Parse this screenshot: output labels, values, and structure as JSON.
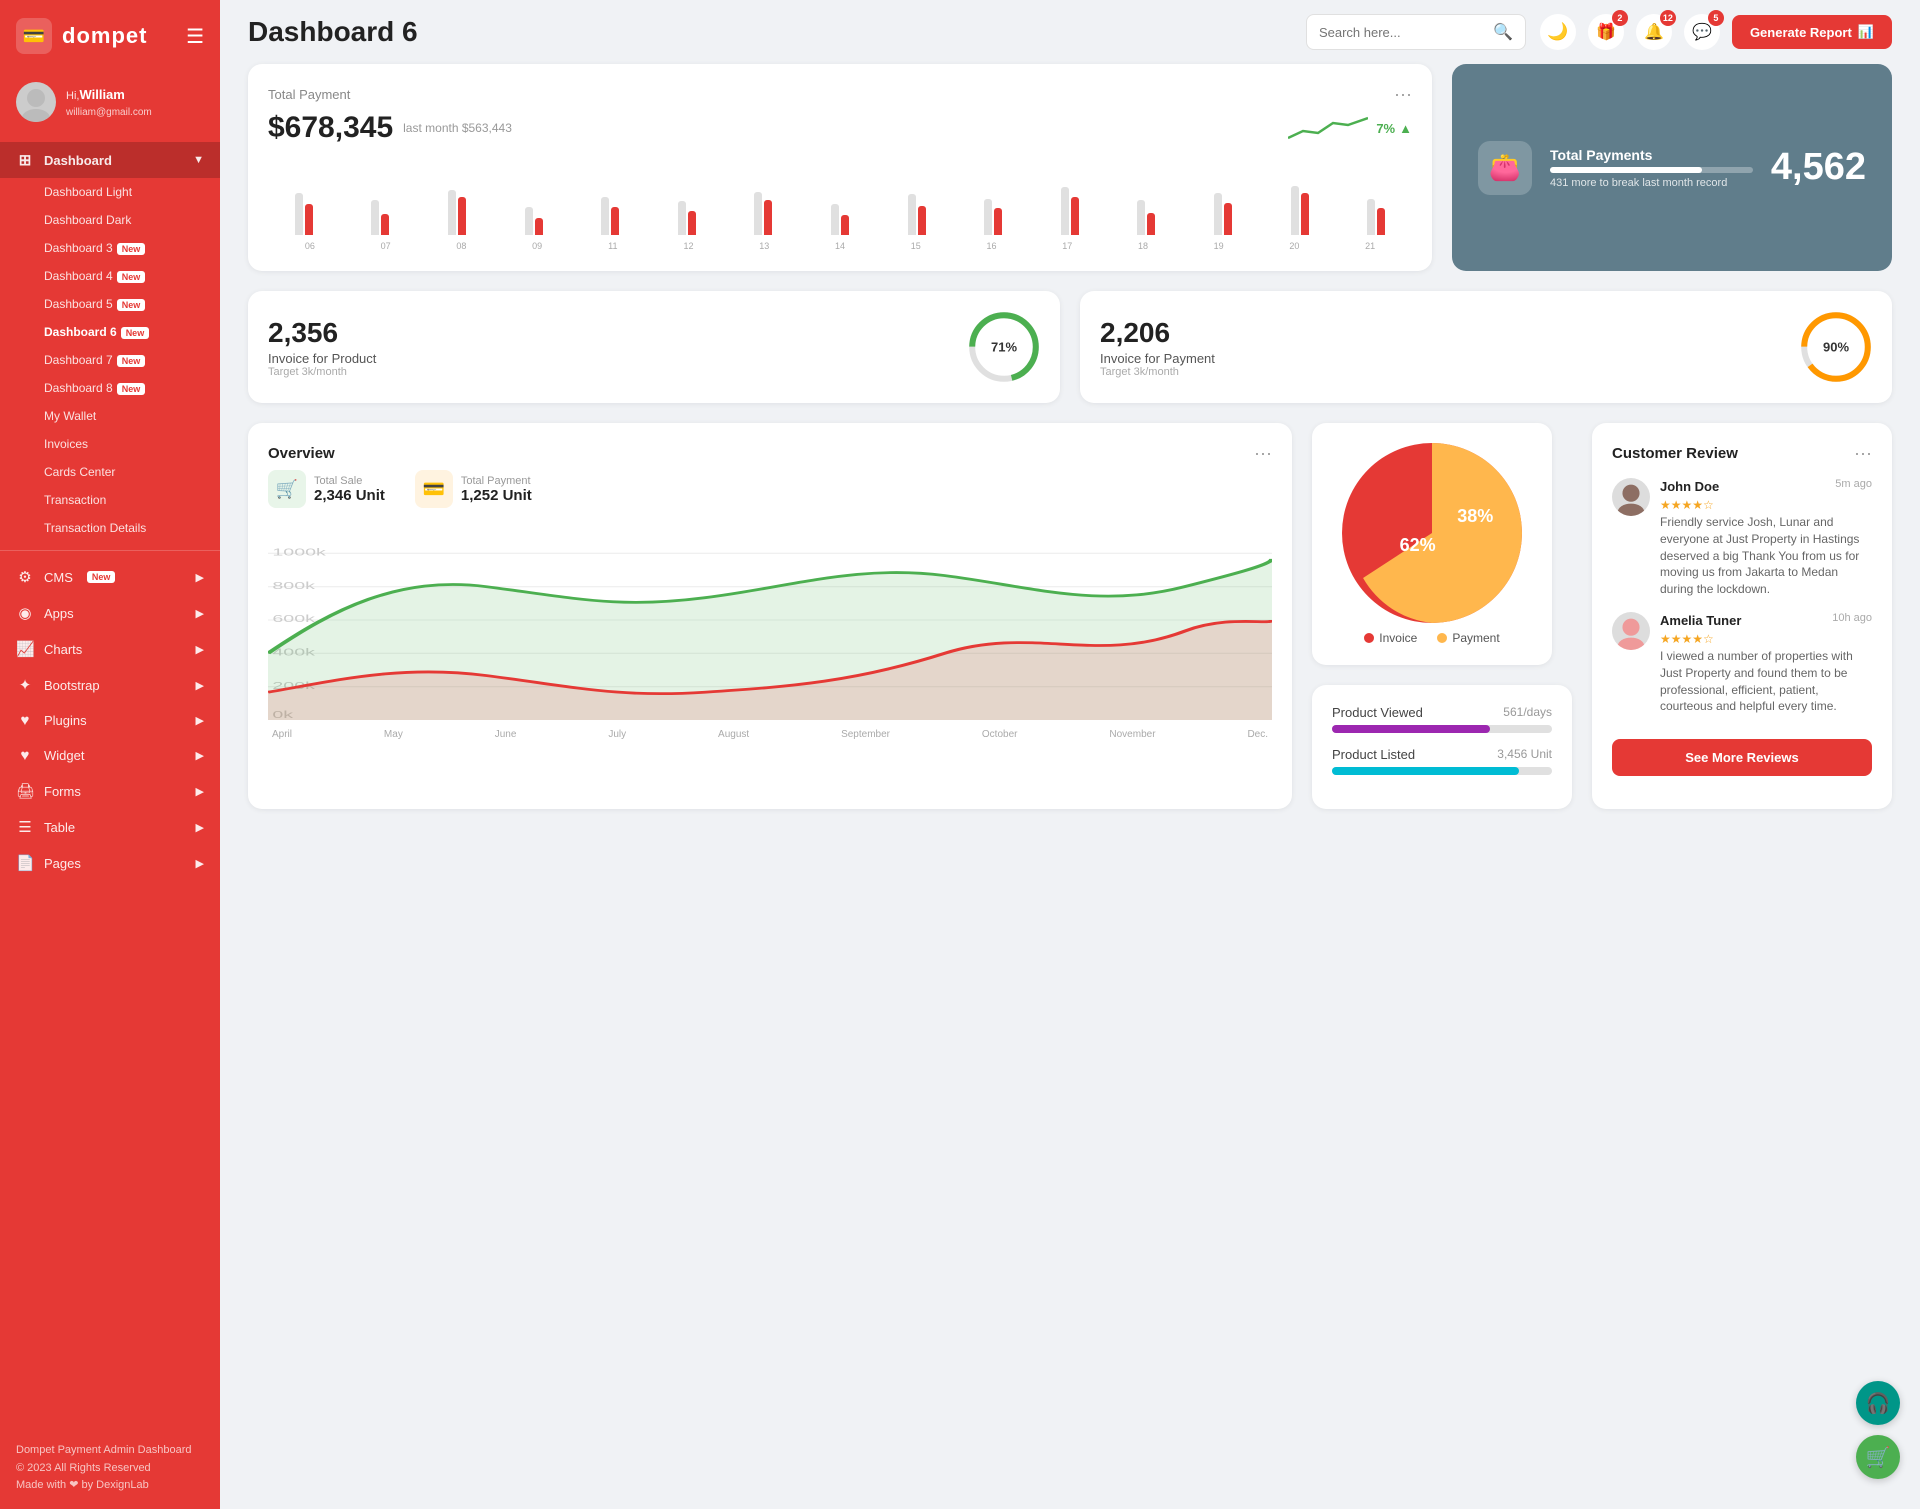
{
  "app": {
    "name": "dompet",
    "logo_icon": "💳"
  },
  "user": {
    "greeting": "Hi,",
    "name": "William",
    "email": "william@gmail.com"
  },
  "header": {
    "title": "Dashboard 6",
    "search_placeholder": "Search here...",
    "generate_report_label": "Generate Report",
    "notifications": {
      "gift_count": "2",
      "bell_count": "12",
      "chat_count": "5"
    }
  },
  "sidebar": {
    "dashboard_label": "Dashboard",
    "sub_items": [
      {
        "label": "Dashboard Light",
        "badge": ""
      },
      {
        "label": "Dashboard Dark",
        "badge": ""
      },
      {
        "label": "Dashboard 3",
        "badge": "New"
      },
      {
        "label": "Dashboard 4",
        "badge": "New"
      },
      {
        "label": "Dashboard 5",
        "badge": "New"
      },
      {
        "label": "Dashboard 6",
        "badge": "New",
        "active": true
      },
      {
        "label": "Dashboard 7",
        "badge": "New"
      },
      {
        "label": "Dashboard 8",
        "badge": "New"
      },
      {
        "label": "My Wallet",
        "badge": ""
      },
      {
        "label": "Invoices",
        "badge": ""
      },
      {
        "label": "Cards Center",
        "badge": ""
      },
      {
        "label": "Transaction",
        "badge": ""
      },
      {
        "label": "Transaction Details",
        "badge": ""
      }
    ],
    "nav_items": [
      {
        "label": "CMS",
        "badge": "New",
        "has_arrow": true
      },
      {
        "label": "Apps",
        "badge": "",
        "has_arrow": true
      },
      {
        "label": "Charts",
        "badge": "",
        "has_arrow": true
      },
      {
        "label": "Bootstrap",
        "badge": "",
        "has_arrow": true
      },
      {
        "label": "Plugins",
        "badge": "",
        "has_arrow": true
      },
      {
        "label": "Widget",
        "badge": "",
        "has_arrow": true
      },
      {
        "label": "Forms",
        "badge": "",
        "has_arrow": true
      },
      {
        "label": "Table",
        "badge": "",
        "has_arrow": true
      },
      {
        "label": "Pages",
        "badge": "",
        "has_arrow": true
      }
    ],
    "footer": {
      "title": "Dompet Payment Admin Dashboard",
      "copyright": "© 2023 All Rights Reserved",
      "made_with": "Made with ❤ by DexignLab"
    }
  },
  "total_payment": {
    "label": "Total Payment",
    "amount": "$678,345",
    "last_month_label": "last month $563,443",
    "trend_percent": "7%",
    "bars": [
      {
        "label": "06",
        "red_h": 45,
        "grey_h": 60
      },
      {
        "label": "07",
        "red_h": 30,
        "grey_h": 50
      },
      {
        "label": "08",
        "red_h": 55,
        "grey_h": 65
      },
      {
        "label": "09",
        "red_h": 25,
        "grey_h": 40
      },
      {
        "label": "11",
        "red_h": 40,
        "grey_h": 55
      },
      {
        "label": "12",
        "red_h": 35,
        "grey_h": 48
      },
      {
        "label": "13",
        "red_h": 50,
        "grey_h": 62
      },
      {
        "label": "14",
        "red_h": 28,
        "grey_h": 45
      },
      {
        "label": "15",
        "red_h": 42,
        "grey_h": 58
      },
      {
        "label": "16",
        "red_h": 38,
        "grey_h": 52
      },
      {
        "label": "17",
        "red_h": 55,
        "grey_h": 68
      },
      {
        "label": "18",
        "red_h": 32,
        "grey_h": 50
      },
      {
        "label": "19",
        "red_h": 46,
        "grey_h": 60
      },
      {
        "label": "20",
        "red_h": 60,
        "grey_h": 70
      },
      {
        "label": "21",
        "red_h": 38,
        "grey_h": 52
      }
    ]
  },
  "total_payments_card": {
    "title": "Total Payments",
    "sub": "431 more to break last month record",
    "value": "4,562",
    "progress": 75
  },
  "invoice_product": {
    "count": "2,356",
    "label": "Invoice for Product",
    "target": "Target 3k/month",
    "percent": 71,
    "color": "#4caf50"
  },
  "invoice_payment": {
    "count": "2,206",
    "label": "Invoice for Payment",
    "target": "Target 3k/month",
    "percent": 90,
    "color": "#ff9800"
  },
  "overview": {
    "label": "Overview",
    "total_sale": {
      "label": "Total Sale",
      "value": "2,346 Unit"
    },
    "total_payment": {
      "label": "Total Payment",
      "value": "1,252 Unit"
    },
    "y_labels": [
      "1000k",
      "800k",
      "600k",
      "400k",
      "200k",
      "0k"
    ],
    "x_labels": [
      "April",
      "May",
      "June",
      "July",
      "August",
      "September",
      "October",
      "November",
      "Dec."
    ]
  },
  "pie_chart": {
    "invoice_pct": 62,
    "payment_pct": 38,
    "invoice_label": "Invoice",
    "payment_label": "Payment",
    "invoice_color": "#e53935",
    "payment_color": "#ffb74d"
  },
  "product_viewed": {
    "label": "Product Viewed",
    "count": "561/days",
    "color": "#9c27b0",
    "fill_pct": 72
  },
  "product_listed": {
    "label": "Product Listed",
    "count": "3,456 Unit",
    "color": "#00bcd4",
    "fill_pct": 85
  },
  "customer_review": {
    "title": "Customer Review",
    "reviews": [
      {
        "name": "John Doe",
        "time": "5m ago",
        "stars": 4,
        "text": "Friendly service Josh, Lunar and everyone at Just Property in Hastings deserved a big Thank You from us for moving us from Jakarta to Medan during the lockdown."
      },
      {
        "name": "Amelia Tuner",
        "time": "10h ago",
        "stars": 4,
        "text": "I viewed a number of properties with Just Property and found them to be professional, efficient, patient, courteous and helpful every time."
      }
    ],
    "see_more_label": "See More Reviews"
  }
}
